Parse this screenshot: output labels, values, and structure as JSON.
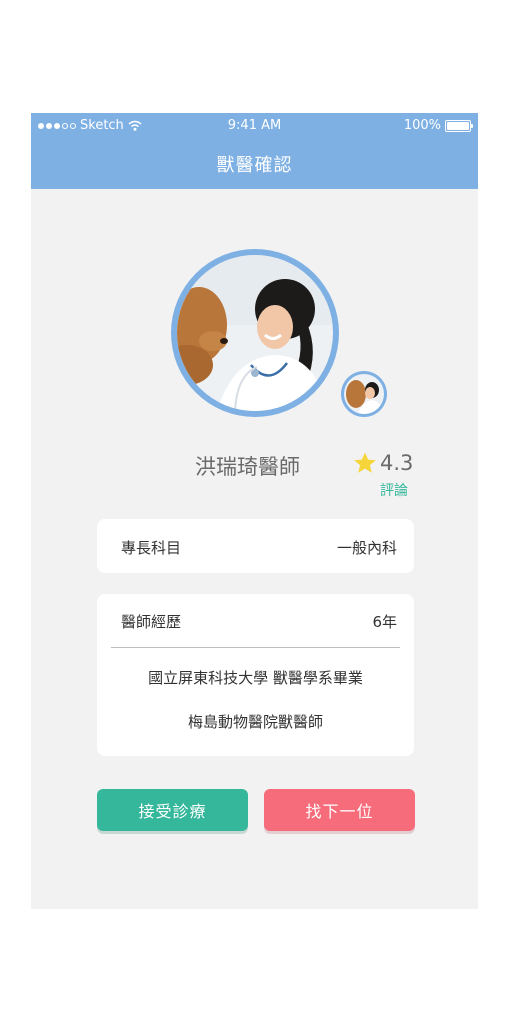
{
  "status_bar": {
    "carrier": "Sketch",
    "time": "9:41 AM",
    "battery": "100%"
  },
  "header": {
    "title": "獸醫確認"
  },
  "doctor": {
    "name": "洪瑞琦醫師",
    "rating": "4.3",
    "review_link": "評論"
  },
  "specialty_card": {
    "label": "專長科目",
    "value": "一般內科"
  },
  "experience_card": {
    "label": "醫師經歷",
    "value": "6年",
    "details": [
      "國立屏東科技大學 獸醫學系畢業",
      "梅島動物醫院獸醫師"
    ]
  },
  "actions": {
    "accept": "接受診療",
    "next": "找下一位"
  },
  "colors": {
    "header_blue": "#7eb0e3",
    "accent_green": "#35b79b",
    "accent_red": "#f66c7a",
    "star_yellow": "#f5d53a"
  }
}
